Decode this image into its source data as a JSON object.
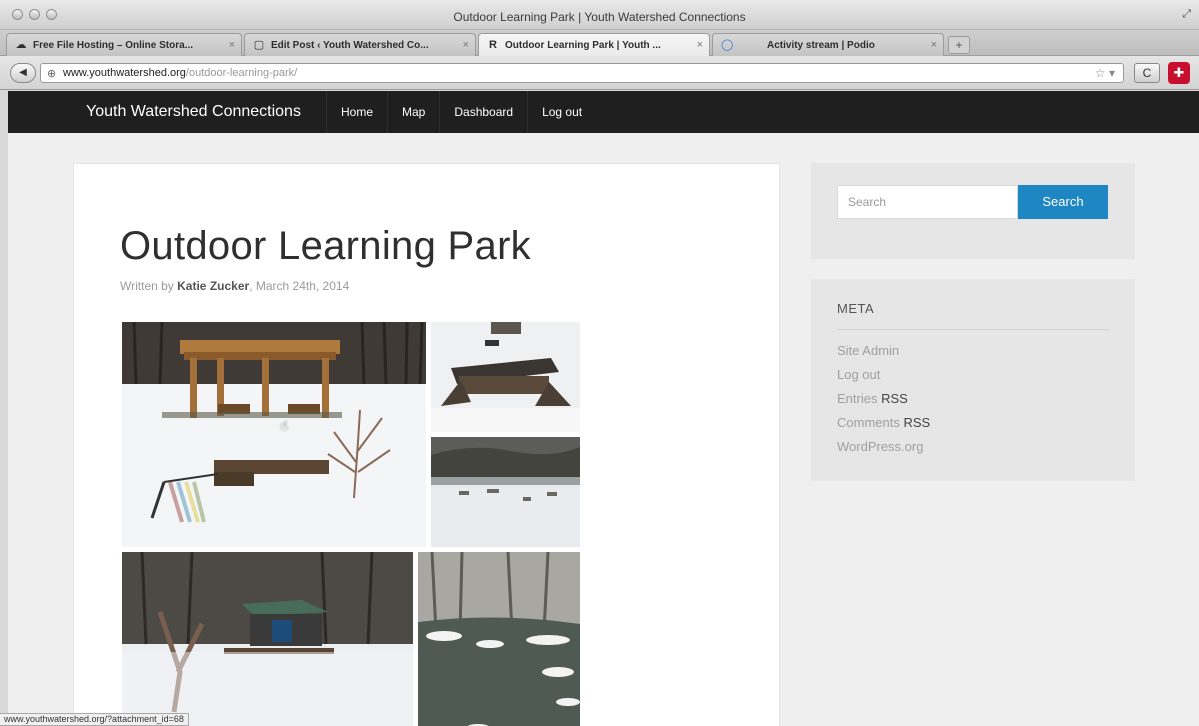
{
  "window": {
    "title": "Outdoor Learning Park | Youth Watershed Connections"
  },
  "tabs": [
    {
      "label": "Free File Hosting – Online Stora...",
      "favicon": "☁"
    },
    {
      "label": "Edit Post ‹ Youth Watershed Co...",
      "favicon": "▢"
    },
    {
      "label": "Outdoor Learning Park | Youth ...",
      "favicon": "R",
      "active": true
    },
    {
      "label": "Activity stream | Podio",
      "favicon": "◯"
    }
  ],
  "address_bar": {
    "domain": "www.youthwatershed.org",
    "path": "/outdoor-learning-park/"
  },
  "site": {
    "title": "Youth Watershed Connections",
    "nav": [
      "Home",
      "Map",
      "Dashboard",
      "Log out"
    ]
  },
  "post": {
    "title": "Outdoor Learning Park",
    "byline_prefix": "Written by",
    "author": "Katie Zucker",
    "date": "March 24th, 2014"
  },
  "sidebar": {
    "search": {
      "placeholder": "Search",
      "button_label": "Search"
    },
    "meta": {
      "heading": "META",
      "links": [
        {
          "label": "Site Admin",
          "suffix": ""
        },
        {
          "label": "Log out",
          "suffix": ""
        },
        {
          "label": "Entries",
          "suffix": "RSS"
        },
        {
          "label": "Comments",
          "suffix": "RSS"
        },
        {
          "label": "WordPress.org",
          "suffix": ""
        }
      ]
    }
  },
  "status_bar": {
    "text": "www.youthwatershed.org/?attachment_id=68"
  },
  "colors": {
    "header_bg": "#1f1f1f",
    "search_button": "#1e86c2",
    "page_bg": "#efefef"
  }
}
